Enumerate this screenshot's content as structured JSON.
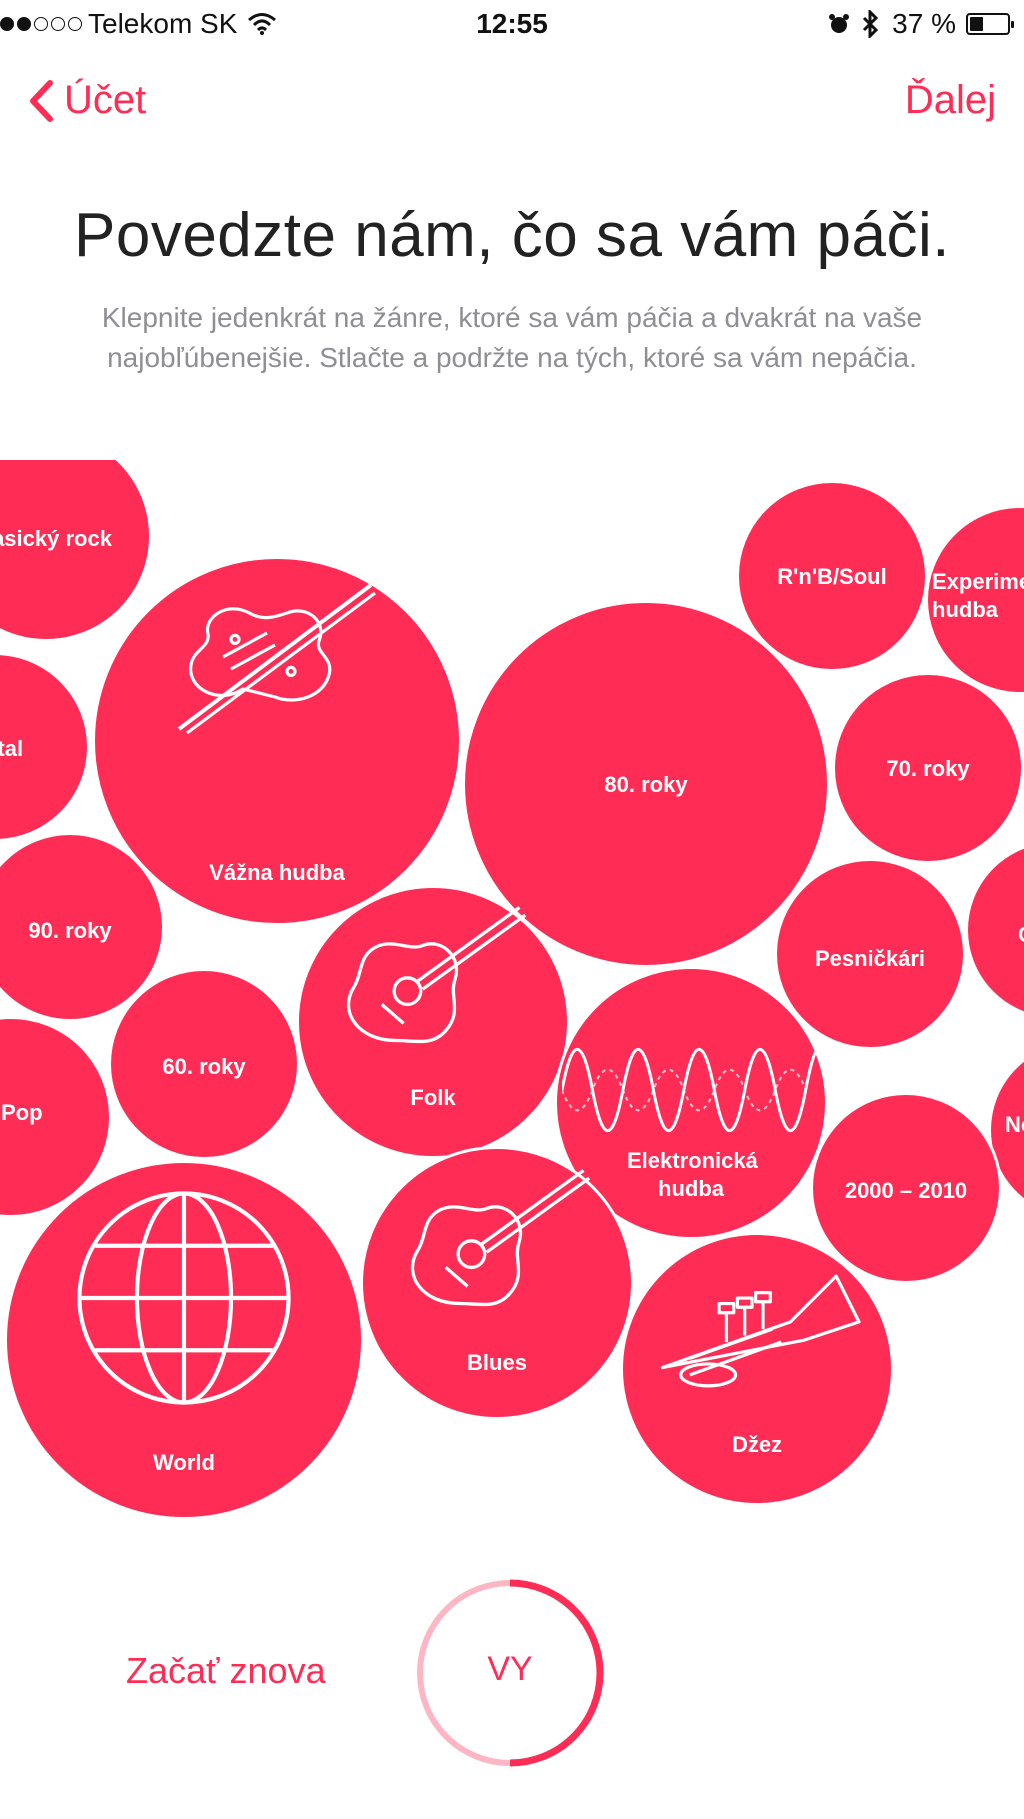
{
  "status_bar": {
    "carrier": "Telekom SK",
    "time": "12:55",
    "battery": "37 %",
    "battery_level": 0.37,
    "signal_dots_filled": 2,
    "signal_dots_total": 5,
    "icons": [
      "signal-dots-icon",
      "wifi-icon",
      "alarm-icon",
      "bluetooth-icon",
      "battery-icon"
    ]
  },
  "nav": {
    "back_label": "Účet",
    "next_label": "Ďalej"
  },
  "title": "Povedzte nám, čo sa vám páči.",
  "subtitle": "Klepnite jedenkrát na žánre, ktoré sa vám páčia a dvakrát na vaše najobľúbenejšie. Stlačte a podržte na tých, ktoré sa vám nepáčia.",
  "accent_color": "#ff2d55",
  "genres": {
    "klasicky_rock": "Klasický rock",
    "vazna_hudba": "Vážna hudba",
    "metal": "Metal",
    "rnb_soul": "R'n'B/Soul",
    "experimental": "Experimentálna hudba",
    "rok80": "80. roky",
    "rok70": "70. roky",
    "rok90": "90. roky",
    "pesnickari": "Pesničkári",
    "country": "Country",
    "folk": "Folk",
    "rok60": "60. roky",
    "pop": "Pop",
    "elektronicka": "Elektronická hudba",
    "new_age": "New age",
    "rok2000": "2000 – 2010",
    "world": "World",
    "blues": "Blues",
    "dzez": "Džez"
  },
  "bottom": {
    "restart_label": "Začať znova",
    "you_label": "VY",
    "you_progress": 0.5
  }
}
